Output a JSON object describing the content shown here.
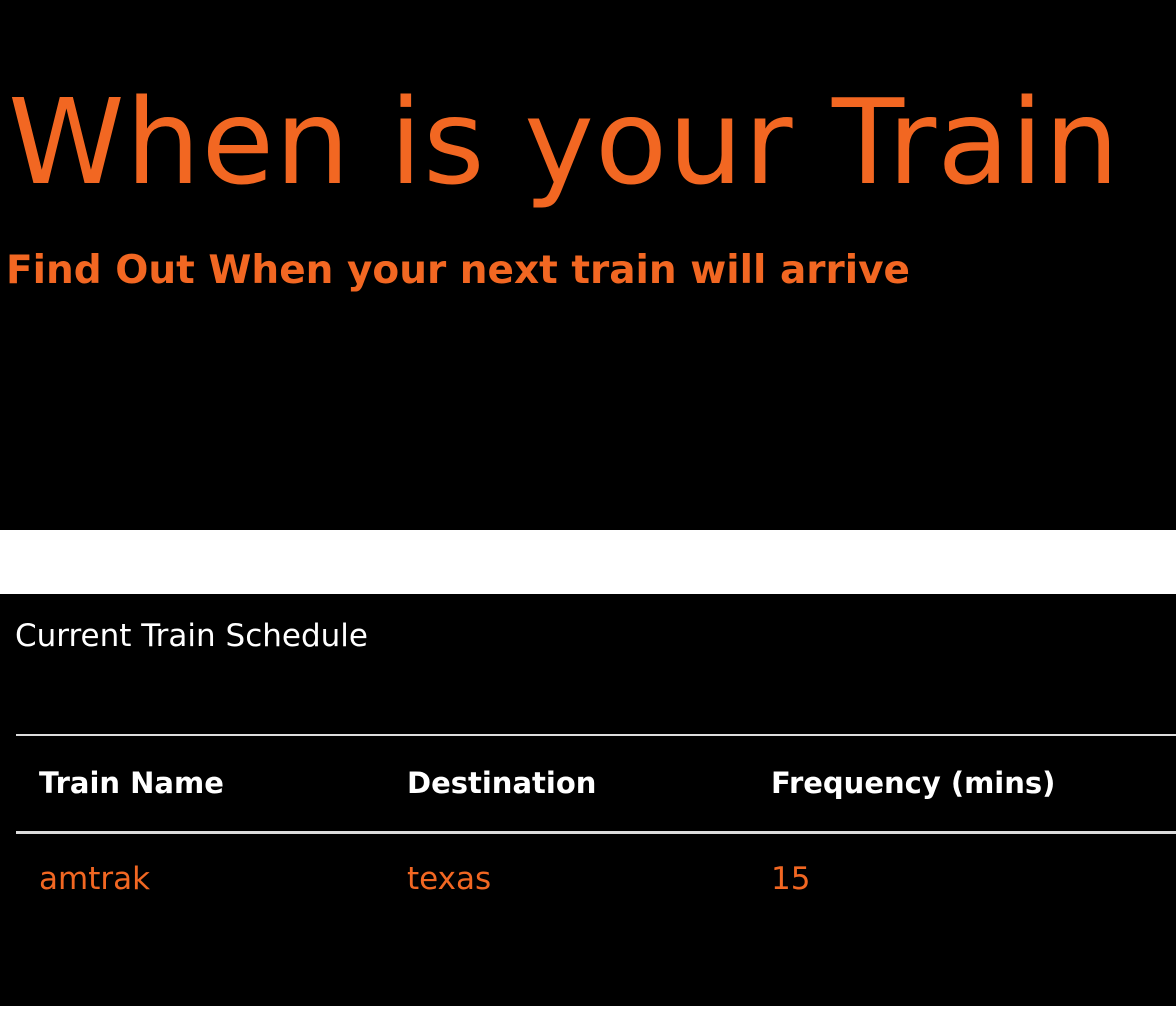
{
  "theme": {
    "accent": "#f26722",
    "background": "#000000",
    "header_text": "#ffffff"
  },
  "hero": {
    "title": "When is your Train",
    "subtitle": "Find Out When your next train will arrive"
  },
  "schedule": {
    "title": "Current Train Schedule",
    "columns": [
      "Train Name",
      "Destination",
      "Frequency (mins)"
    ],
    "rows": [
      [
        "amtrak",
        "texas",
        "15"
      ]
    ]
  }
}
